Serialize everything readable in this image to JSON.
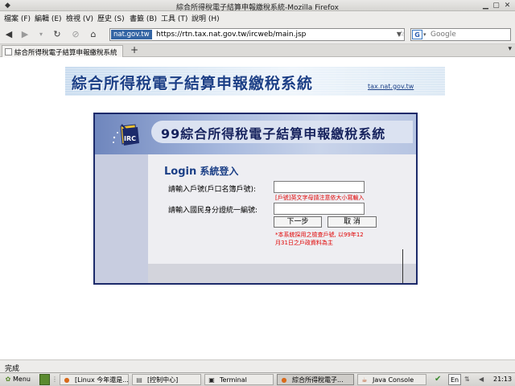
{
  "window": {
    "title": "綜合所得稅電子結算申報繳稅系統-Mozilla Firefox"
  },
  "menu": [
    {
      "label": "檔案 (F)"
    },
    {
      "label": "編輯 (E)"
    },
    {
      "label": "檢視 (V)"
    },
    {
      "label": "歷史 (S)"
    },
    {
      "label": "書籤 (B)"
    },
    {
      "label": "工具 (T)"
    },
    {
      "label": "說明 (H)"
    }
  ],
  "nav": {
    "site_label": "nat.gov.tw",
    "url": "https://rtn.tax.nat.gov.tw/ircweb/main.jsp",
    "search_engine_icon": "G",
    "search_placeholder": "Google"
  },
  "tabs": [
    {
      "label": "綜合所得稅電子結算申報繳稅系統"
    }
  ],
  "tab_new": "+",
  "banner": {
    "title": "綜合所得稅電子結算申報繳稅系統",
    "site": "tax.nat.gov.tw"
  },
  "login": {
    "icon_text": "IRC",
    "title": "99綜合所得稅電子結算申報繳稅系統",
    "heading_en": "Login",
    "heading_zh": "系統登入",
    "household_label": "請輸入戶號(戶口名簿戶號):",
    "household_value": "",
    "household_note": "[戶號]英文字母請注意依大小寫輸入",
    "id_label": "請輸入國民身分證統一編號:",
    "id_value": "",
    "next_button": "下一步",
    "cancel_button": "取 消",
    "footnote_line1": "*本系統採用之檢查戶號, 以99年12",
    "footnote_line2": "月31日之戶政資料為主"
  },
  "status": {
    "text": "完成"
  },
  "taskbar": {
    "menu_label": "Menu",
    "items": [
      {
        "label": "[Linux 今年還是...",
        "icon": "firefox-icon"
      },
      {
        "label": "[控制中心]",
        "icon": "control-center-icon"
      },
      {
        "label": "Terminal",
        "icon": "terminal-icon"
      },
      {
        "label": "綜合所得稅電子...",
        "icon": "firefox-icon",
        "active": true
      },
      {
        "label": "Java Console",
        "icon": "java-icon"
      }
    ],
    "lang": "En",
    "clock": "21:13"
  },
  "colors": {
    "accent": "#1b3f86",
    "login_border": "#1c2a6a",
    "note_red": "#e00000"
  }
}
